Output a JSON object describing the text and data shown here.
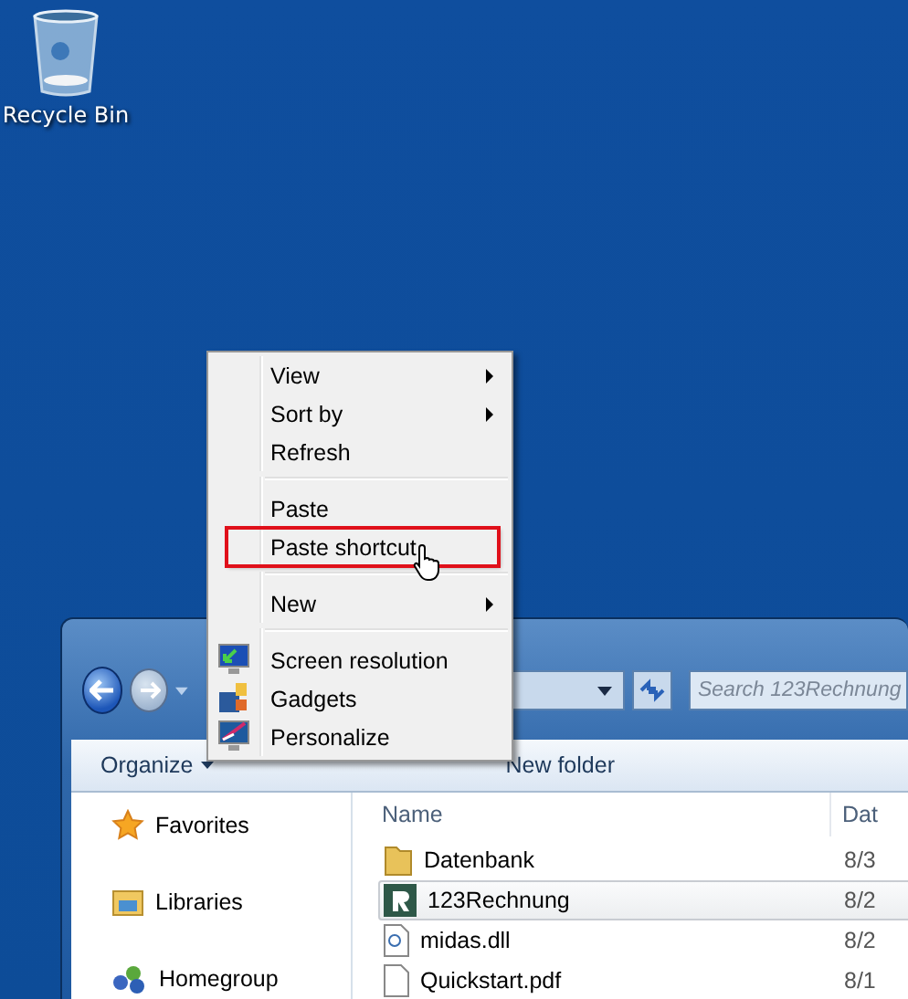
{
  "desktop_icons": [
    {
      "label": "Recycle Bin"
    }
  ],
  "explorer": {
    "search": {
      "placeholder": "Search 123Rechnung"
    },
    "toolbar": [
      {
        "label": "Organize",
        "dropdown": true
      },
      {
        "label": "New folder",
        "dropdown": false
      }
    ],
    "nav_pane": [
      {
        "label": "Favorites"
      },
      {
        "label": "Libraries"
      },
      {
        "label": "Homegroup"
      }
    ],
    "columns": [
      "Name",
      "Dat"
    ],
    "files": [
      {
        "name": "Datenbank",
        "date": "8/3",
        "selected": false
      },
      {
        "name": "123Rechnung",
        "date": "8/2",
        "selected": true
      },
      {
        "name": "midas.dll",
        "date": "8/2",
        "selected": false
      },
      {
        "name": "Quickstart.pdf",
        "date": "8/1",
        "selected": false
      }
    ]
  },
  "context_menu": {
    "groups": [
      [
        {
          "label": "View",
          "submenu": true,
          "highlighted": false
        },
        {
          "label": "Sort by",
          "submenu": true,
          "highlighted": false
        },
        {
          "label": "Refresh",
          "submenu": false,
          "highlighted": false
        }
      ],
      [
        {
          "label": "Paste",
          "submenu": false,
          "highlighted": false
        },
        {
          "label": "Paste shortcut",
          "submenu": false,
          "highlighted": true
        }
      ],
      [
        {
          "label": "New",
          "submenu": true,
          "highlighted": false
        }
      ],
      [
        {
          "label": "Screen resolution",
          "submenu": false,
          "highlighted": false
        },
        {
          "label": "Gadgets",
          "submenu": false,
          "highlighted": false
        },
        {
          "label": "Personalize",
          "submenu": false,
          "highlighted": false
        }
      ]
    ]
  }
}
